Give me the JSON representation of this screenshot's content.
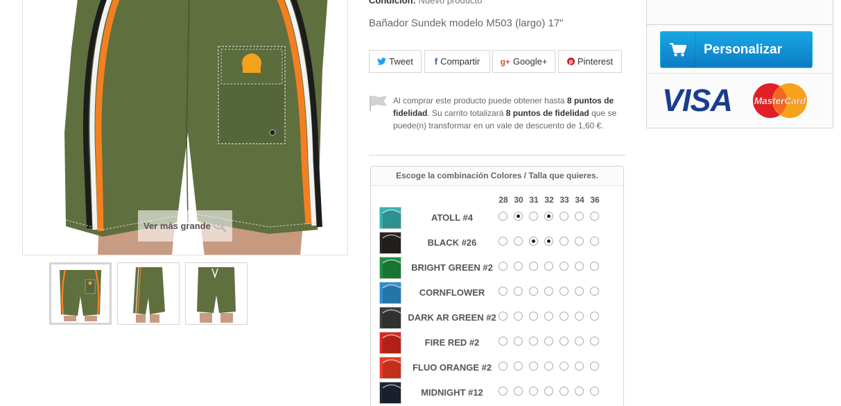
{
  "product": {
    "condition_label": "Condición:",
    "condition_value": "Nuevo producto",
    "short_description": "Bañador Sundek modelo M503 (largo) 17\""
  },
  "image": {
    "zoom_label": "Ver más grande"
  },
  "share": {
    "tweet": "Tweet",
    "facebook": "Compartir",
    "google": "Google+",
    "pinterest": "Pinterest"
  },
  "loyalty": {
    "t1": "Al comprar este producto puede obtener hasta ",
    "b1": "8 puntos de fidelidad",
    "t2": ". Su carrito totalizará ",
    "b2": "8 puntos de fidelidad",
    "t3": " que se puede(n) transformar en un vale de descuento de 1,60 €."
  },
  "combinations": {
    "title": "Escoge la combinación Colores / Talla que quieres.",
    "sizes": [
      "28",
      "30",
      "31",
      "32",
      "33",
      "34",
      "36"
    ],
    "rows": [
      {
        "name": "ATOLL #4",
        "swatch": "#35b3b0",
        "checked": [
          false,
          true,
          false,
          true,
          false,
          false,
          false
        ]
      },
      {
        "name": "BLACK #26",
        "swatch": "#2a2523",
        "checked": [
          false,
          false,
          true,
          true,
          false,
          false,
          false
        ]
      },
      {
        "name": "BRIGHT GREEN #2",
        "swatch": "#1f8e3e",
        "checked": [
          false,
          false,
          false,
          false,
          false,
          false,
          false
        ]
      },
      {
        "name": "CORNFLOWER",
        "swatch": "#2e8fd0",
        "checked": [
          false,
          false,
          false,
          false,
          false,
          false,
          false
        ]
      },
      {
        "name": "DARK AR GREEN #2",
        "swatch": "#3a3e3a",
        "checked": [
          false,
          false,
          false,
          false,
          false,
          false,
          false
        ]
      },
      {
        "name": "FIRE RED #2",
        "swatch": "#d9291f",
        "checked": [
          false,
          false,
          false,
          false,
          false,
          false,
          false
        ]
      },
      {
        "name": "FLUO ORANGE #2",
        "swatch": "#ee3a22",
        "checked": [
          false,
          false,
          false,
          false,
          false,
          false,
          false
        ]
      },
      {
        "name": "MIDNIGHT #12",
        "swatch": "#1f2636",
        "checked": [
          false,
          false,
          false,
          false,
          false,
          false,
          false
        ]
      }
    ]
  },
  "sidebar": {
    "customize_button": "Personalizar",
    "visa_text": "VISA",
    "mastercard_text": "MasterCard"
  },
  "colors": {
    "accent_blue": "#1a94d8",
    "shorts_green": "#5d6e3f",
    "stripe_orange": "#f07a1a"
  }
}
